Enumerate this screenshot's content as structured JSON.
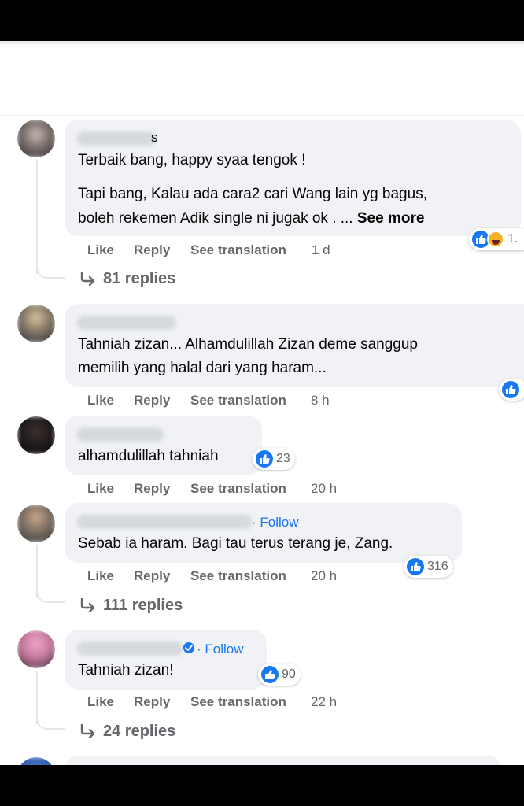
{
  "comments": [
    {
      "name_suffix": "s",
      "lines": [
        "Terbaik bang, happy syaa tengok !"
      ],
      "lines2": [
        "Tapi bang, Kalau ada cara2 cari Wang lain yg bagus,",
        "boleh rekemen Adik single ni jugak ok . ..."
      ],
      "see_more": "See more",
      "reaction_count": "1.",
      "actions": {
        "like": "Like",
        "reply": "Reply",
        "translate": "See translation",
        "time": "1 d"
      },
      "replies": "81 replies"
    },
    {
      "lines": [
        "Tahniah zizan... Alhamdulillah Zizan deme sanggup",
        "memilih yang halal dari yang haram..."
      ],
      "actions": {
        "like": "Like",
        "reply": "Reply",
        "translate": "See translation",
        "time": "8 h"
      }
    },
    {
      "lines": [
        "alhamdulillah tahniah"
      ],
      "reaction_count": "23",
      "actions": {
        "like": "Like",
        "reply": "Reply",
        "translate": "See translation",
        "time": "20 h"
      }
    },
    {
      "follow": "Follow",
      "lines": [
        "Sebab ia haram. Bagi tau terus terang je, Zang."
      ],
      "reaction_count": "316",
      "actions": {
        "like": "Like",
        "reply": "Reply",
        "translate": "See translation",
        "time": "20 h"
      },
      "replies": "111 replies"
    },
    {
      "follow": "Follow",
      "lines": [
        "Tahniah zizan!"
      ],
      "reaction_count": "90",
      "actions": {
        "like": "Like",
        "reply": "Reply",
        "translate": "See translation",
        "time": "22 h"
      },
      "replies": "24 replies"
    }
  ],
  "colors": {
    "link": "#1877f2",
    "muted": "#65676b",
    "bubble": "#f0f2f5",
    "text": "#050505"
  },
  "icons": [
    "like-reaction-icon",
    "haha-reaction-icon",
    "reply-arrow-icon",
    "verified-badge-icon"
  ]
}
